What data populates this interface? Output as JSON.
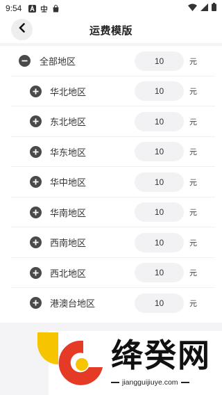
{
  "status_bar": {
    "time": "9:54",
    "left_icons": [
      "a-letter-icon",
      "chinese-char-icon",
      "shopping-bag-icon"
    ],
    "right_icons": [
      "wifi-icon",
      "signal-icon",
      "battery-icon"
    ]
  },
  "header": {
    "title": "运费模版",
    "back_icon": "chevron-left-icon"
  },
  "regions": {
    "all": {
      "name": "全部地区",
      "fee": "10",
      "unit": "元",
      "icon": "minus-circle-icon"
    },
    "items": [
      {
        "name": "华北地区",
        "fee": "10",
        "unit": "元",
        "icon": "plus-circle-icon"
      },
      {
        "name": "东北地区",
        "fee": "10",
        "unit": "元",
        "icon": "plus-circle-icon"
      },
      {
        "name": "华东地区",
        "fee": "10",
        "unit": "元",
        "icon": "plus-circle-icon"
      },
      {
        "name": "华中地区",
        "fee": "10",
        "unit": "元",
        "icon": "plus-circle-icon"
      },
      {
        "name": "华南地区",
        "fee": "10",
        "unit": "元",
        "icon": "plus-circle-icon"
      },
      {
        "name": "西南地区",
        "fee": "10",
        "unit": "元",
        "icon": "plus-circle-icon"
      },
      {
        "name": "西北地区",
        "fee": "10",
        "unit": "元",
        "icon": "plus-circle-icon"
      },
      {
        "name": "港澳台地区",
        "fee": "10",
        "unit": "元",
        "icon": "plus-circle-icon"
      }
    ]
  },
  "watermark": {
    "brand": "绛癸网",
    "url": "jiangguijiuye.com",
    "colors": {
      "red": "#e43a26",
      "yellow": "#f6c400"
    }
  }
}
